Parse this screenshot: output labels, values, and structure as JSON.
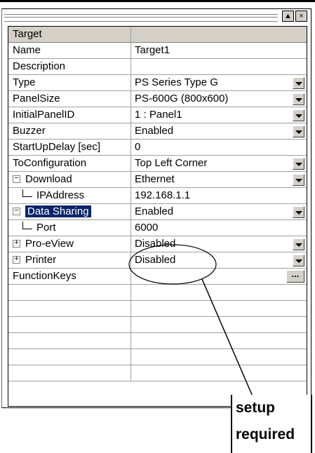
{
  "window": {
    "buttons": [
      {
        "name": "pin-button",
        "glyph": "▲"
      },
      {
        "name": "close-button",
        "glyph": "×"
      }
    ]
  },
  "grid": {
    "header": {
      "col1": "Target",
      "col2": ""
    },
    "rows": [
      {
        "label": "Name",
        "value": "Target1"
      },
      {
        "label": "Description",
        "value": ""
      },
      {
        "label": "Type",
        "value": "PS Series Type G"
      },
      {
        "label": "PanelSize",
        "value": "PS-600G (800x600)"
      },
      {
        "label": "InitialPanelID",
        "value": "1 : Panel1"
      },
      {
        "label": "Buzzer",
        "value": "Enabled"
      },
      {
        "label": "StartUpDelay [sec]",
        "value": "0"
      },
      {
        "label": "ToConfiguration",
        "value": "Top Left Corner"
      },
      {
        "label": "Download",
        "value": "Ethernet",
        "toggle": "−"
      },
      {
        "label": "IPAddress",
        "value": "192.168.1.1"
      },
      {
        "label": "Data Sharing",
        "value": "Enabled",
        "toggle": "−"
      },
      {
        "label": "Port",
        "value": "6000"
      },
      {
        "label": "Pro-eView",
        "value": "Disabled",
        "toggle": "+"
      },
      {
        "label": "Printer",
        "value": "Disabled",
        "toggle": "+"
      },
      {
        "label": "FunctionKeys",
        "value": "",
        "ellipsis": "..."
      }
    ]
  },
  "callout": {
    "line1": "setup",
    "line2": "required"
  },
  "colors": {
    "selection": "#0a246a",
    "face": "#d4d0c8"
  }
}
